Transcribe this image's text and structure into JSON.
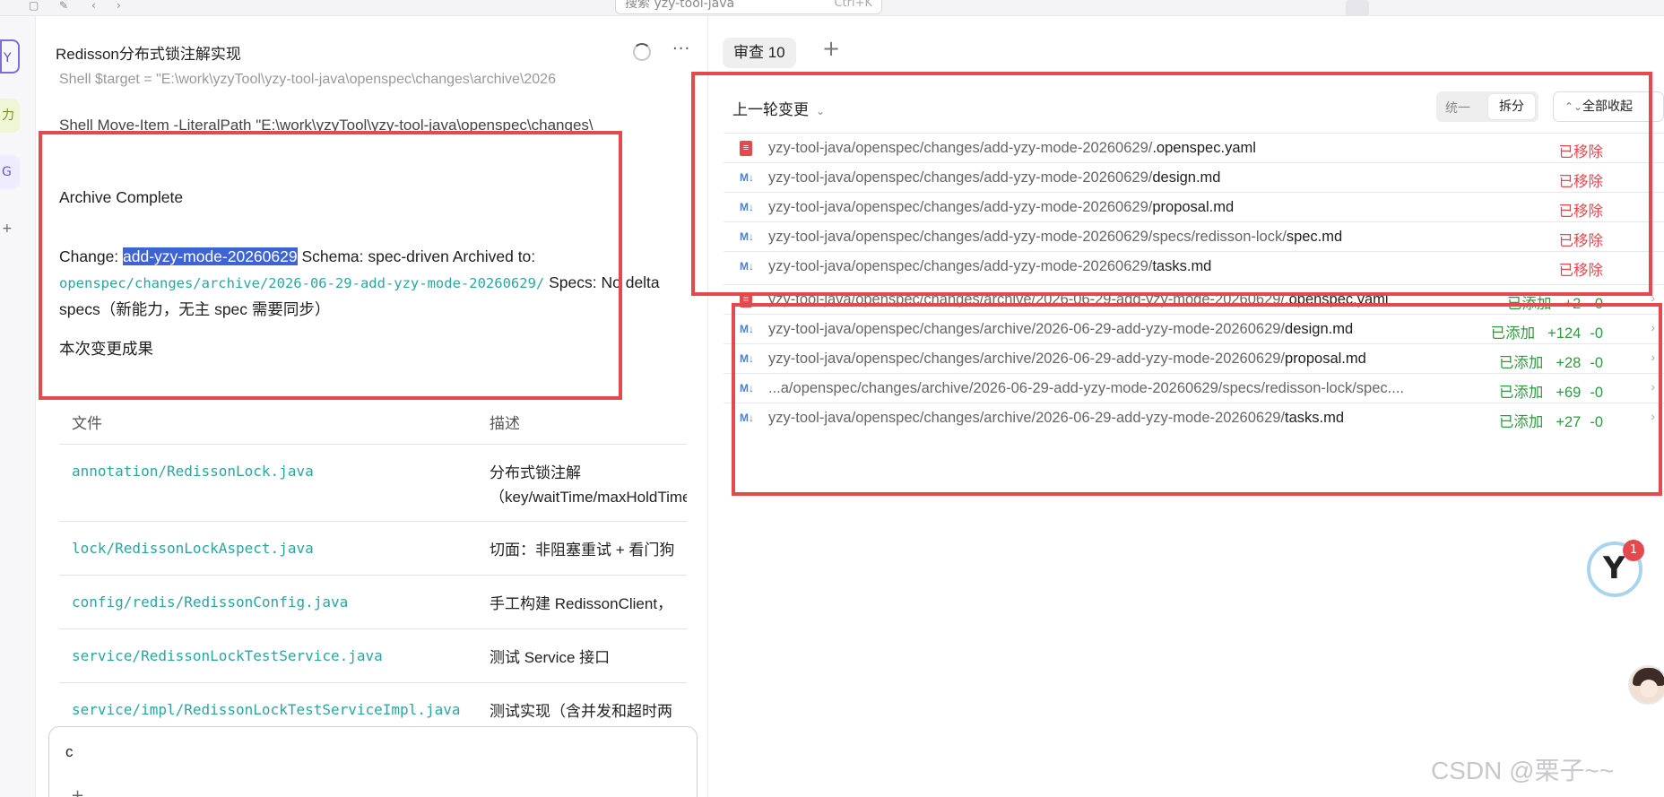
{
  "topbar": {
    "search_placeholder": "搜索 yzy-tool-java",
    "search_shortcut": "Ctrl+K"
  },
  "rail": {
    "items": [
      "Y",
      "力",
      "G",
      "+"
    ]
  },
  "conversation": {
    "title": "Redisson分布式锁注解实现",
    "line_target": "Shell  $target = \"E:\\work\\yzyTool\\yzy-tool-java\\openspec\\changes\\archive\\2026",
    "line_move": "Shell  Move-Item -LiteralPath \"E:\\work\\yzyTool\\yzy-tool-java\\openspec\\changes\\",
    "archive_heading": "Archive Complete",
    "change_label": "Change: ",
    "change_value": "add-yzy-mode-20260629",
    "change_rest": " Schema: spec-driven Archived to:",
    "archive_path": "openspec/changes/archive/2026-06-29-add-yzy-mode-20260629/",
    "specs_tail": " Specs: No delta",
    "specs_line2": "specs（新能力，无主 spec 需要同步）",
    "result_heading": "本次变更成果",
    "table": {
      "col_file": "文件",
      "col_desc": "描述",
      "rows": [
        {
          "file": "annotation/RedissonLock.java",
          "desc": "分布式锁注解（key/waitTime/maxHoldTime"
        },
        {
          "file": "lock/RedissonLockAspect.java",
          "desc": "切面：非阻塞重试 + 看门狗续"
        },
        {
          "file": "config/redis/RedissonConfig.java",
          "desc": "手工构建 RedissonClient，复"
        },
        {
          "file": "service/RedissonLockTestService.java",
          "desc": "测试 Service 接口"
        },
        {
          "file": "service/impl/RedissonLockTestServiceImpl.java",
          "desc": "测试实现（含并发和超时两个"
        }
      ]
    },
    "input_value": "c",
    "input_plus": "+",
    "send_icon": "↑"
  },
  "review": {
    "tab_label": "审查 10",
    "tab_add": "+",
    "round_label": "上一轮变更",
    "view_unified": "统一",
    "view_split": "拆分",
    "collapse_all": "全部收起",
    "files": [
      {
        "icon": "yaml",
        "dir": "yzy-tool-java/openspec/changes/add-yzy-mode-20260629/",
        "name": ".openspec.yaml",
        "status": "已移除",
        "kind": "removed",
        "add": "",
        "del": ""
      },
      {
        "icon": "md",
        "dir": "yzy-tool-java/openspec/changes/add-yzy-mode-20260629/",
        "name": "design.md",
        "status": "已移除",
        "kind": "removed",
        "add": "",
        "del": ""
      },
      {
        "icon": "md",
        "dir": "yzy-tool-java/openspec/changes/add-yzy-mode-20260629/",
        "name": "proposal.md",
        "status": "已移除",
        "kind": "removed",
        "add": "",
        "del": ""
      },
      {
        "icon": "md",
        "dir": "yzy-tool-java/openspec/changes/add-yzy-mode-20260629/specs/redisson-lock/",
        "name": "spec.md",
        "status": "已移除",
        "kind": "removed",
        "add": "",
        "del": ""
      },
      {
        "icon": "md",
        "dir": "yzy-tool-java/openspec/changes/add-yzy-mode-20260629/",
        "name": "tasks.md",
        "status": "已移除",
        "kind": "removed",
        "add": "",
        "del": ""
      },
      {
        "icon": "yaml",
        "dir": "yzy-tool-java/openspec/changes/archive/2026-06-29-add-yzy-mode-20260629/",
        "name": ".openspec.yaml",
        "status": "已添加",
        "kind": "added",
        "add": "+2",
        "del": "-0"
      },
      {
        "icon": "md",
        "dir": "yzy-tool-java/openspec/changes/archive/2026-06-29-add-yzy-mode-20260629/",
        "name": "design.md",
        "status": "已添加",
        "kind": "added",
        "add": "+124",
        "del": "-0"
      },
      {
        "icon": "md",
        "dir": "yzy-tool-java/openspec/changes/archive/2026-06-29-add-yzy-mode-20260629/",
        "name": "proposal.md",
        "status": "已添加",
        "kind": "added",
        "add": "+28",
        "del": "-0"
      },
      {
        "icon": "md",
        "dir": "...a/openspec/changes/archive/2026-06-29-add-yzy-mode-20260629/specs/redisson-lock/spec....",
        "name": "",
        "status": "已添加",
        "kind": "added",
        "add": "+69",
        "del": "-0"
      },
      {
        "icon": "md",
        "dir": "yzy-tool-java/openspec/changes/archive/2026-06-29-add-yzy-mode-20260629/",
        "name": "tasks.md",
        "status": "已添加",
        "kind": "added",
        "add": "+27",
        "del": "-0"
      }
    ]
  },
  "assistant_badge": {
    "letter": "Y",
    "count": "1"
  },
  "watermark": "CSDN @栗子~~",
  "colors": {
    "annotation_red": "#e5484d",
    "removed": "#e5484d",
    "added": "#2f9a3f",
    "link": "#2aa6a0",
    "selection": "#3e63d6"
  }
}
